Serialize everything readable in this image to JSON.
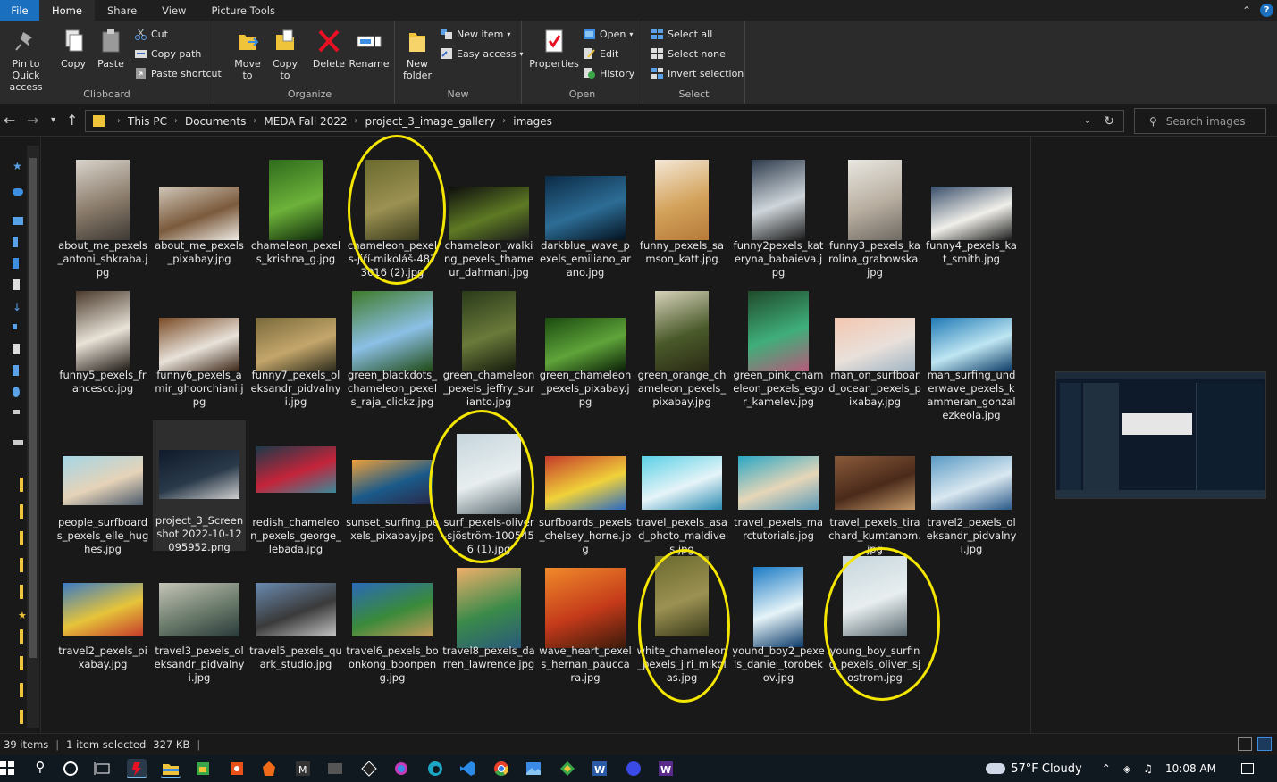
{
  "tabs": {
    "file": "File",
    "home": "Home",
    "share": "Share",
    "view": "View",
    "picture_tools": "Picture Tools",
    "help": "?"
  },
  "ribbon": {
    "clipboard": {
      "label": "Clipboard",
      "pin": "Pin to Quick access",
      "copy": "Copy",
      "paste": "Paste",
      "cut": "Cut",
      "copy_path": "Copy path",
      "paste_shortcut": "Paste shortcut"
    },
    "organize": {
      "label": "Organize",
      "move_to": "Move to",
      "copy_to": "Copy to",
      "delete": "Delete",
      "rename": "Rename"
    },
    "new": {
      "label": "New",
      "new_folder": "New folder",
      "new_item": "New item",
      "easy_access": "Easy access"
    },
    "open": {
      "label": "Open",
      "properties": "Properties",
      "open": "Open",
      "edit": "Edit",
      "history": "History"
    },
    "select": {
      "label": "Select",
      "select_all": "Select all",
      "select_none": "Select none",
      "invert": "Invert selection"
    }
  },
  "address": {
    "crumbs": [
      "This PC",
      "Documents",
      "MEDA Fall 2022",
      "project_3_image_gallery",
      "images"
    ],
    "search_placeholder": "Search images"
  },
  "files": [
    {
      "name": "about_me_pexels_antoni_shkraba.jpg",
      "colors": [
        "#d9d4cc",
        "#8a7b6a",
        "#3d3934"
      ]
    },
    {
      "name": "about_me_pexels_pixabay.jpg",
      "colors": [
        "#cfc6b8",
        "#7b5a3c",
        "#efece6"
      ]
    },
    {
      "name": "chameleon_pexels_krishna_g.jpg",
      "colors": [
        "#2f6b1c",
        "#6db23a",
        "#0f2a0a"
      ]
    },
    {
      "name": "chameleon_pexels-jiří-mikoláš-4873016 (2).jpg",
      "colors": [
        "#6b6a2e",
        "#9b9152",
        "#3a3a1c"
      ]
    },
    {
      "name": "chameleon_walking_pexels_thameur_dahmani.jpg",
      "colors": [
        "#0d0d0d",
        "#5e7a24",
        "#1b1b1b"
      ]
    },
    {
      "name": "darkblue_wave_pexels_emiliano_arano.jpg",
      "colors": [
        "#0b2a45",
        "#2d6d96",
        "#04121f"
      ]
    },
    {
      "name": "funny_pexels_samson_katt.jpg",
      "colors": [
        "#f4e7d6",
        "#d3a25a",
        "#b57a39"
      ]
    },
    {
      "name": "funny2pexels_kateryna_babaieva.jpg",
      "colors": [
        "#2e3b4c",
        "#cfd6db",
        "#1a1a1a"
      ]
    },
    {
      "name": "funny3_pexels_karolina_grabowska.jpg",
      "colors": [
        "#e9e7e1",
        "#b8aea0",
        "#6f6a63"
      ]
    },
    {
      "name": "funny4_pexels_kat_smith.jpg",
      "colors": [
        "#3a4f6c",
        "#f0efe9",
        "#1c1c1c"
      ]
    },
    {
      "name": "funny5_pexels_francesco.jpg",
      "colors": [
        "#4a3a2c",
        "#e9e3d8",
        "#1d1712"
      ]
    },
    {
      "name": "funny6_pexels_amir_ghoorchiani.jpg",
      "colors": [
        "#7a4a24",
        "#e8e2da",
        "#3a2414"
      ]
    },
    {
      "name": "funny7_pexels_oleksandr_pidvalnyi.jpg",
      "colors": [
        "#7a6a3c",
        "#c4a66b",
        "#2a2a1a"
      ]
    },
    {
      "name": "green_blackdots_chameleon_pexels_raja_clickz.jpg",
      "colors": [
        "#3f7a2a",
        "#8cc0e6",
        "#1f4a14"
      ]
    },
    {
      "name": "green_chameleon_pexels_jeffry_surianto.jpg",
      "colors": [
        "#2a3a1a",
        "#6a7a3a",
        "#141a0c"
      ]
    },
    {
      "name": "green_chameleon_pexels_pixabay.jpg",
      "colors": [
        "#1a4a0f",
        "#5fa43a",
        "#0a1f06"
      ]
    },
    {
      "name": "green_orange_chameleon_pexels_pixabay.jpg",
      "colors": [
        "#d7d2bb",
        "#4a5a2a",
        "#2a2a14"
      ]
    },
    {
      "name": "green_pink_chameleon_pexels_egor_kamelev.jpg",
      "colors": [
        "#1f4a2a",
        "#3fae7a",
        "#b75a7a"
      ]
    },
    {
      "name": "man_on_surfboard_ocean_pexels_pixabay.jpg",
      "colors": [
        "#f4c7b0",
        "#e9e0da",
        "#9fb4c3"
      ]
    },
    {
      "name": "man_surfing_underwave_pexels_kammeran_gonzalezkeola.jpg",
      "colors": [
        "#1f79b5",
        "#bfe6f2",
        "#0a3a66"
      ]
    },
    {
      "name": "people_surfboards_pexels_elle_hughes.jpg",
      "colors": [
        "#a5d6e6",
        "#e6d3b8",
        "#4a5a6a"
      ]
    },
    {
      "name": "project_3_Screenshot 2022-10-12 095952.png",
      "colors": [
        "#0f1a2a",
        "#2a3a4a",
        "#d0d0d0"
      ]
    },
    {
      "name": "redish_chameleon_pexels_george_lebada.jpg",
      "colors": [
        "#1a3a4a",
        "#c4243a",
        "#3a8a9a"
      ]
    },
    {
      "name": "sunset_surfing_pexels_pixabay.jpg",
      "colors": [
        "#f0a03a",
        "#1a5a8a",
        "#2a2a4a"
      ]
    },
    {
      "name": "surf_pexels-oliver-sjöström-1005456 (1).jpg",
      "colors": [
        "#c6d6dc",
        "#e8eef0",
        "#5a6a70"
      ]
    },
    {
      "name": "surfboards_pexels_chelsey_horne.jpg",
      "colors": [
        "#c43a2a",
        "#f0d23a",
        "#2a6ac4"
      ]
    },
    {
      "name": "travel_pexels_asad_photo_maldives.jpg",
      "colors": [
        "#5ad0e6",
        "#e6f4f8",
        "#2a8ab0"
      ]
    },
    {
      "name": "travel_pexels_marctutorials.jpg",
      "colors": [
        "#2aa6c4",
        "#e6d6b8",
        "#5a9ab8"
      ]
    },
    {
      "name": "travel_pexels_tirachard_kumtanom.jpg",
      "colors": [
        "#8a5a3a",
        "#4a2a1a",
        "#c49a6a"
      ]
    },
    {
      "name": "travel2_pexels_oleksandr_pidvalnyi.jpg",
      "colors": [
        "#5a9ac4",
        "#dae8f0",
        "#2a5a8a"
      ]
    },
    {
      "name": "travel2_pexels_pixabay.jpg",
      "colors": [
        "#3a7ac4",
        "#e6c43a",
        "#c43a2a"
      ]
    },
    {
      "name": "travel3_pexels_oleksandr_pidvalnyi.jpg",
      "colors": [
        "#c4c4b8",
        "#6a7a6a",
        "#2a3a3a"
      ]
    },
    {
      "name": "travel5_pexels_quark_studio.jpg",
      "colors": [
        "#6a8ab0",
        "#3a3a3a",
        "#c4c4c4"
      ]
    },
    {
      "name": "travel6_pexels_boonkong_boonpeng.jpg",
      "colors": [
        "#2a6ab8",
        "#3a8a3a",
        "#c49a5a"
      ]
    },
    {
      "name": "travel8_pexels_darren_lawrence.jpg",
      "colors": [
        "#f0b06a",
        "#3a8a4a",
        "#2a5a7a"
      ]
    },
    {
      "name": "wave_heart_pexels_hernan_pauccara.jpg",
      "colors": [
        "#f08a2a",
        "#c43a1a",
        "#3a1a0a"
      ]
    },
    {
      "name": "white_chameleon_pexels_jiri_mikolas.jpg",
      "colors": [
        "#6b6a2e",
        "#9b9152",
        "#3a3a1c"
      ]
    },
    {
      "name": "yound_boy2_pexels_daniel_torobekov.jpg",
      "colors": [
        "#1a7ac4",
        "#e6f4f8",
        "#0a3a6a"
      ]
    },
    {
      "name": "young_boy_surfing_pexels_oliver_sjostrom.jpg",
      "colors": [
        "#c6d6dc",
        "#e8eef0",
        "#5a6a70"
      ]
    }
  ],
  "status": {
    "count": "39 items",
    "selected": "1 item selected",
    "size": "327 KB"
  },
  "taskbar": {
    "weather": "57°F  Cloudy",
    "time": "10:08 AM"
  },
  "accent": "#1a6fbf",
  "highlight": "#f4e600"
}
